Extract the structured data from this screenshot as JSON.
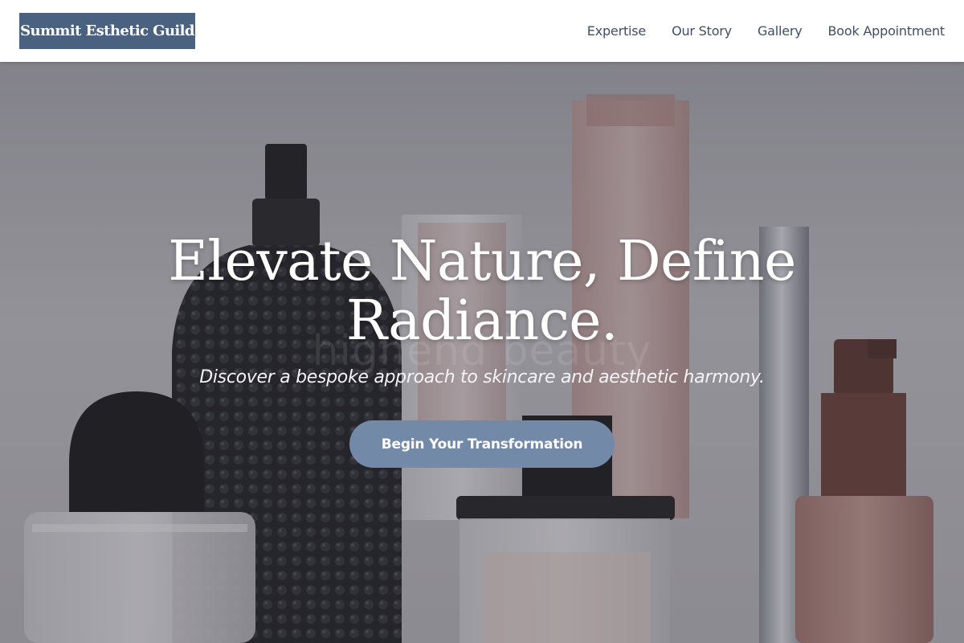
{
  "brand": {
    "name": "Summit Esthetic Guild",
    "color": "#4a6280"
  },
  "nav": {
    "items": [
      {
        "label": "Expertise"
      },
      {
        "label": "Our Story"
      },
      {
        "label": "Gallery"
      },
      {
        "label": "Book Appointment"
      }
    ]
  },
  "hero": {
    "title": "Elevate Nature, Define Radiance.",
    "subtitle": "Discover a bespoke approach to skincare and aesthetic harmony.",
    "cta_label": "Begin Your Transformation",
    "cta_color": "#7289a8",
    "background_watermark": "highend beauty",
    "background_image": "perfume-bottles-photo"
  }
}
